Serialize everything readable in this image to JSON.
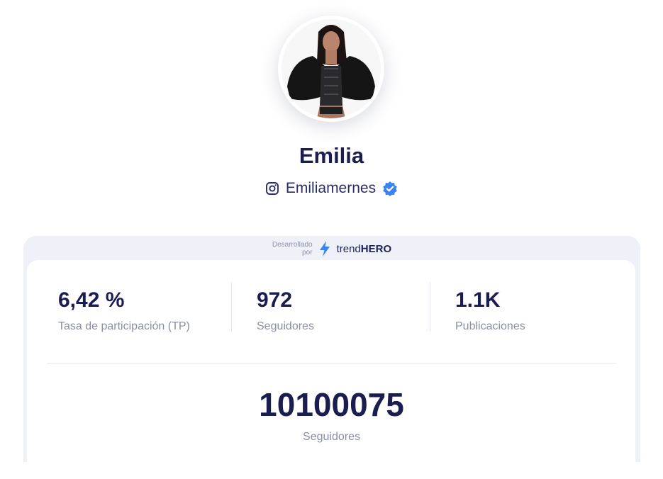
{
  "profile": {
    "name": "Emilia",
    "handle": "Emiliamernes",
    "platform_icon": "instagram-icon",
    "verified_icon": "verified-badge-icon"
  },
  "powered_by": {
    "line1": "Desarrollado",
    "line2": "por",
    "brand_light": "trend",
    "brand_bold": "HERO",
    "icon": "bolt-icon"
  },
  "stats": [
    {
      "value": "6,42 %",
      "label": "Tasa de participación (TP)"
    },
    {
      "value": "972",
      "label": "Seguidores"
    },
    {
      "value": "1.1K",
      "label": "Publicaciones"
    }
  ],
  "followers": {
    "value": "10100075",
    "label": "Seguidores"
  },
  "colors": {
    "primary_text": "#1a1d4e",
    "muted_text": "#8a8fa3",
    "accent_blue": "#3b82f6",
    "card_background": "#eef1f7"
  }
}
